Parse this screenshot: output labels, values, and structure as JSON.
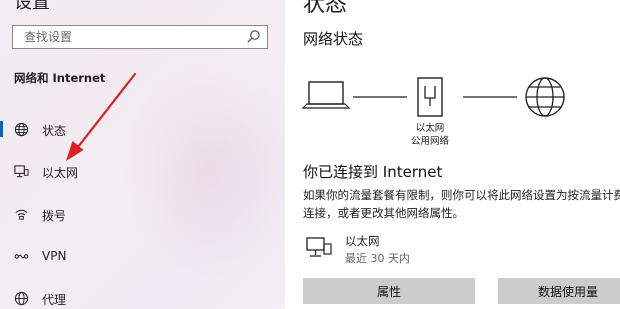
{
  "sidebar": {
    "top_partial": "设置",
    "search": {
      "placeholder": "查找设置",
      "icon": "search-icon"
    },
    "section_title": "网络和 Internet",
    "items": [
      {
        "label": "状态",
        "icon": "globe-icon",
        "active": true
      },
      {
        "label": "以太网",
        "icon": "ethernet-icon",
        "active": false
      },
      {
        "label": "拨号",
        "icon": "dialup-icon",
        "active": false
      },
      {
        "label": "VPN",
        "icon": "vpn-icon",
        "active": false
      },
      {
        "label": "代理",
        "icon": "proxy-globe-icon",
        "active": false
      }
    ],
    "annotation_arrow_color": "#e02020"
  },
  "main": {
    "top_partial": "状态",
    "title": "网络状态",
    "diagram": {
      "node_label_1": "以太网",
      "node_label_2": "公用网络"
    },
    "connected_title": "你已连接到 Internet",
    "description": "如果你的流量套餐有限制，则你可以将此网络设置为按流量计费的连接，或者更改其他网络属性。",
    "adapter": {
      "name": "以太网",
      "usage": "最近 30 天内"
    },
    "buttons": {
      "properties": "属性",
      "data_usage": "数据使用量"
    }
  },
  "colors": {
    "accent": "#0067c0",
    "button_bg": "#cccccc",
    "arrow": "#e02020"
  }
}
